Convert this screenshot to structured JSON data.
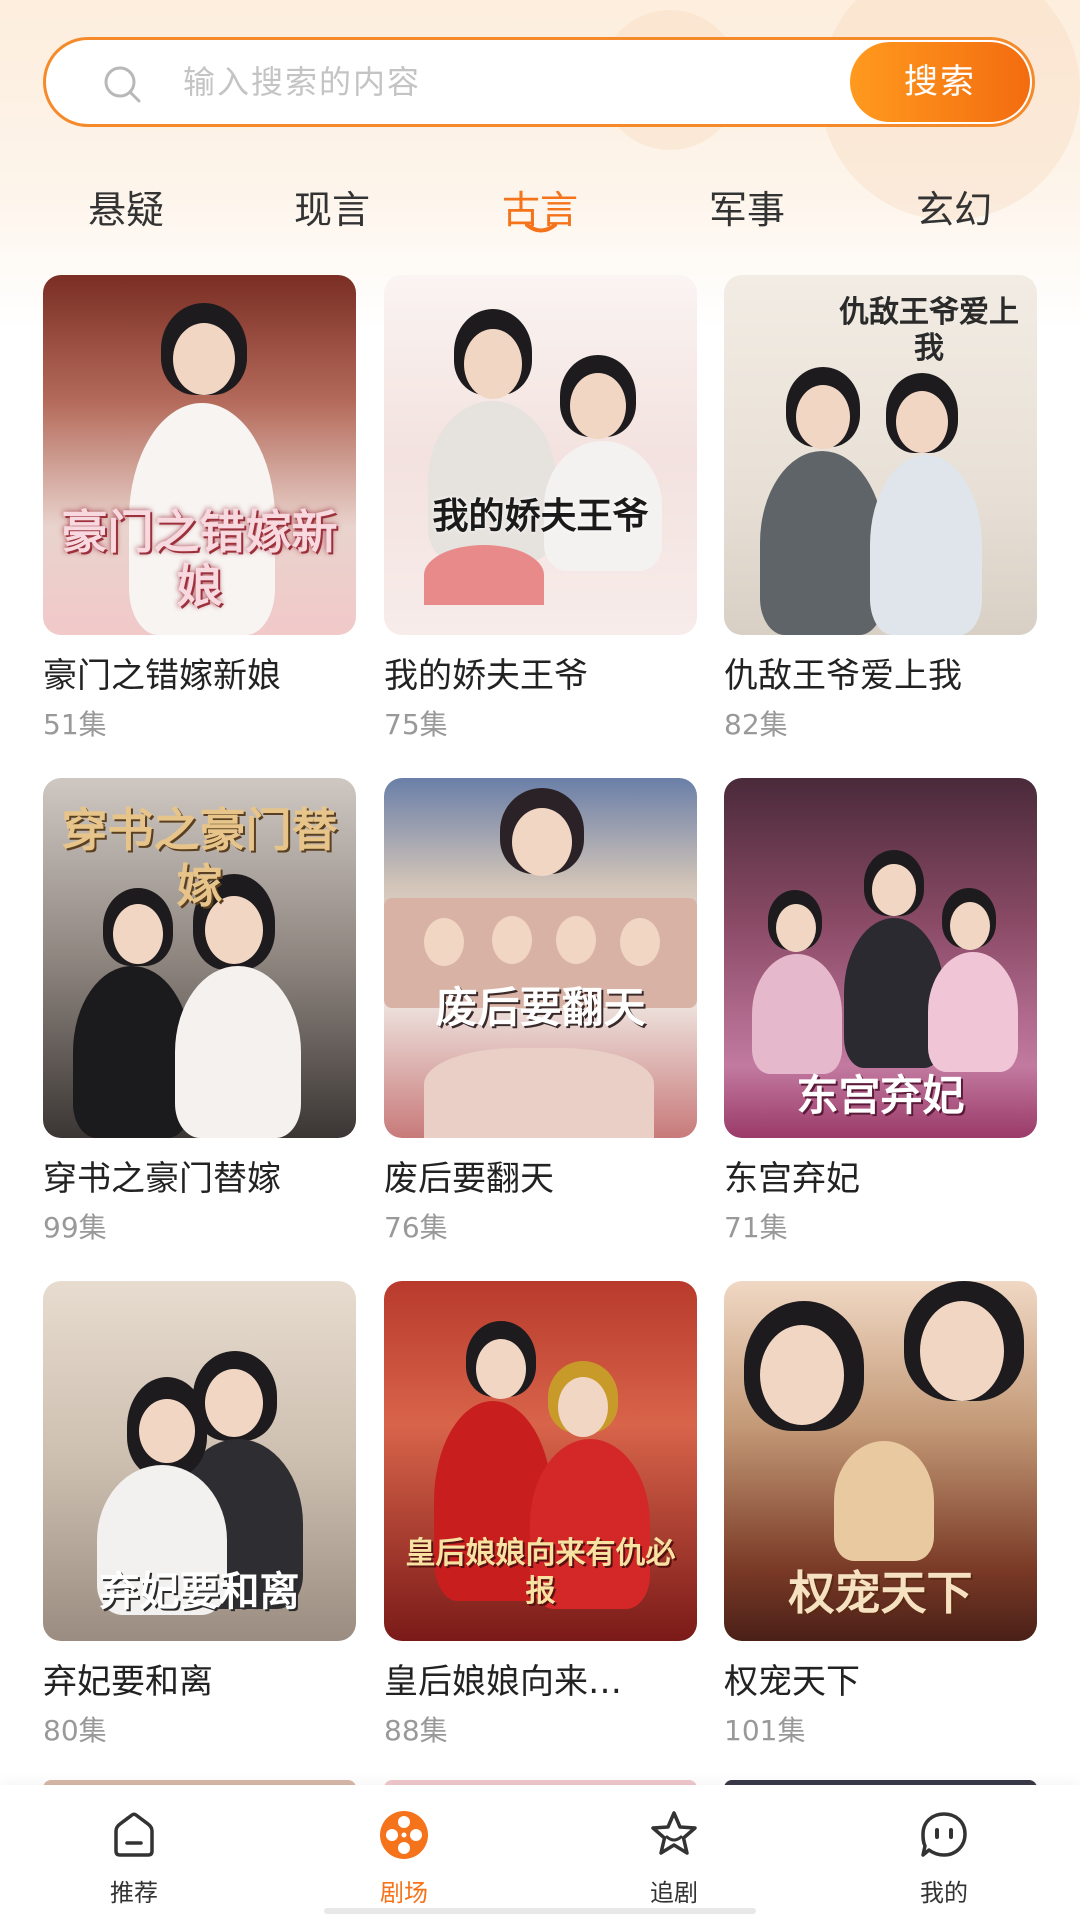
{
  "search": {
    "placeholder": "输入搜索的内容",
    "button_label": "搜索",
    "accent_color": "#f5731a"
  },
  "tabs": [
    {
      "label": "悬疑",
      "active": false
    },
    {
      "label": "现言",
      "active": false
    },
    {
      "label": "古言",
      "active": true
    },
    {
      "label": "军事",
      "active": false
    },
    {
      "label": "玄幻",
      "active": false
    }
  ],
  "dramas": [
    {
      "title": "豪门之错嫁新娘",
      "episodes": "51集",
      "poster_text": "豪门之错嫁新娘"
    },
    {
      "title": "我的娇夫王爷",
      "episodes": "75集",
      "poster_text": "我的娇夫王爷"
    },
    {
      "title": "仇敌王爷爱上我",
      "episodes": "82集",
      "poster_text": "仇敌王爷爱上我"
    },
    {
      "title": "穿书之豪门替嫁",
      "episodes": "99集",
      "poster_text": "穿书之豪门替嫁"
    },
    {
      "title": "废后要翻天",
      "episodes": "76集",
      "poster_text": "废后要翻天"
    },
    {
      "title": "东宫弃妃",
      "episodes": "71集",
      "poster_text": "东宫弃妃"
    },
    {
      "title": "弃妃要和离",
      "episodes": "80集",
      "poster_text": "弃妃要和离"
    },
    {
      "title": "皇后娘娘向来…",
      "episodes": "88集",
      "poster_text": "皇后娘娘向来有仇必报"
    },
    {
      "title": "权宠天下",
      "episodes": "101集",
      "poster_text": "权宠天下"
    }
  ],
  "bottom_nav": [
    {
      "label": "推荐",
      "icon": "home-icon",
      "active": false
    },
    {
      "label": "剧场",
      "icon": "film-reel-icon",
      "active": true
    },
    {
      "label": "追剧",
      "icon": "star-icon",
      "active": false
    },
    {
      "label": "我的",
      "icon": "profile-face-icon",
      "active": false
    }
  ]
}
